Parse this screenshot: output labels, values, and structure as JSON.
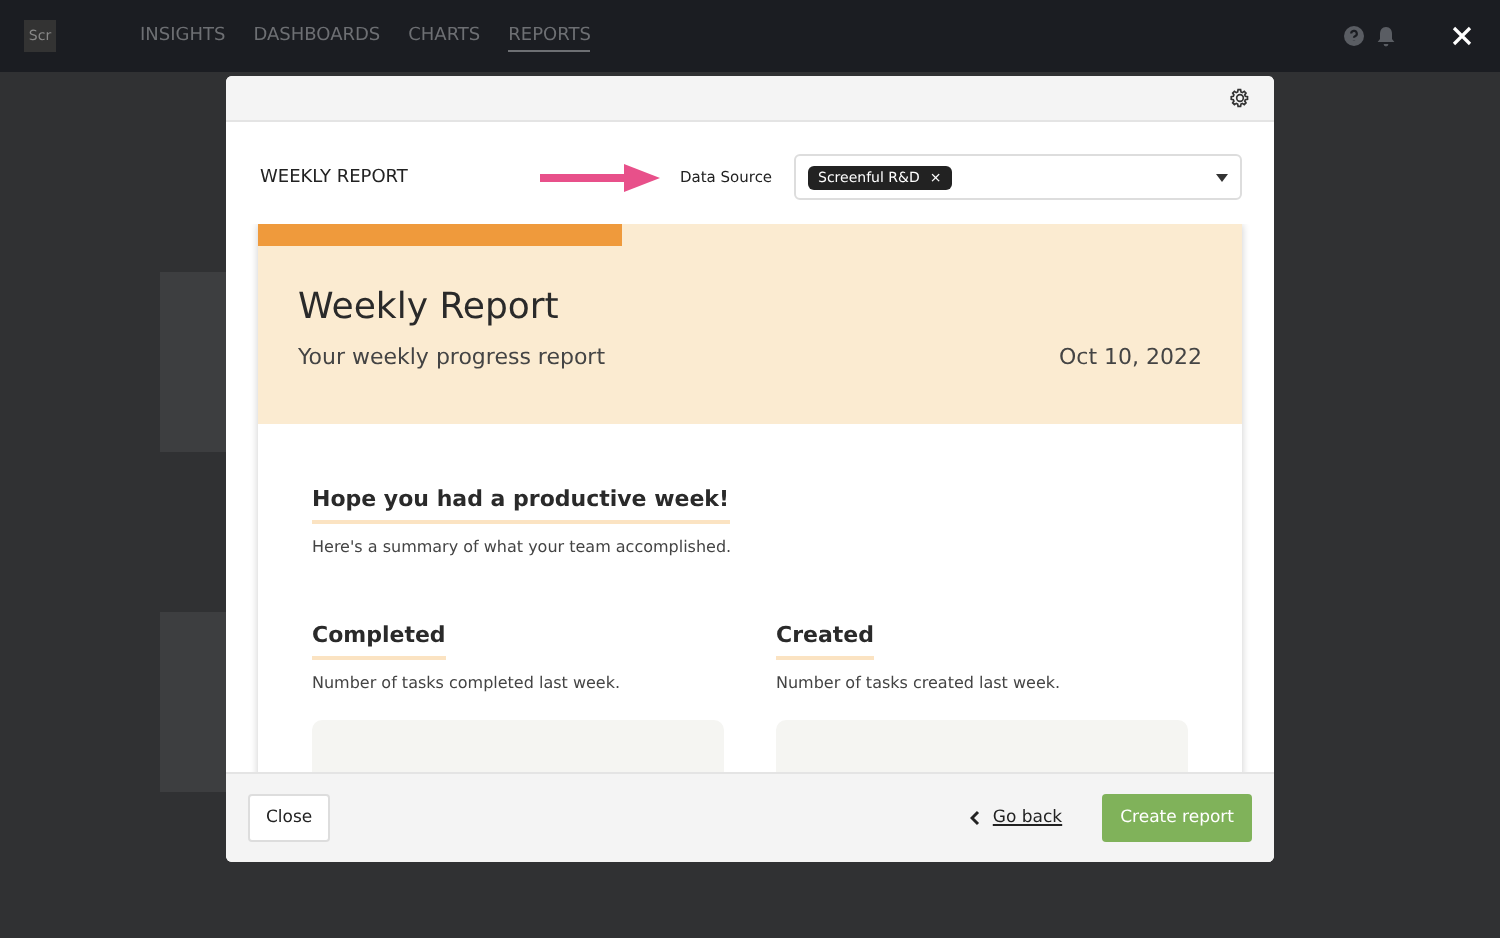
{
  "nav": {
    "logo": "Scr",
    "tabs": [
      {
        "label": "INSIGHTS",
        "selected": false
      },
      {
        "label": "DASHBOARDS",
        "selected": false
      },
      {
        "label": "CHARTS",
        "selected": false
      },
      {
        "label": "REPORTS",
        "selected": true
      }
    ]
  },
  "background": {
    "cards": [
      {
        "kind": "report"
      },
      {
        "kind": "report"
      }
    ]
  },
  "modal": {
    "title": "WEEKLY REPORT",
    "data_source_label": "Data Source",
    "sources": [
      "Screenful R&D"
    ],
    "remove_symbol": "×",
    "preview": {
      "title": "Weekly Report",
      "subtitle": "Your weekly progress report",
      "date": "Oct 10, 2022",
      "greeting": "Hope you had a productive week!",
      "summary": "Here's a summary of what your team accomplished.",
      "sections": [
        {
          "title": "Completed",
          "description": "Number of tasks completed last week."
        },
        {
          "title": "Created",
          "description": "Number of tasks created last week."
        }
      ]
    },
    "buttons": {
      "close": "Close",
      "back": "Go back",
      "create": "Create report"
    }
  }
}
